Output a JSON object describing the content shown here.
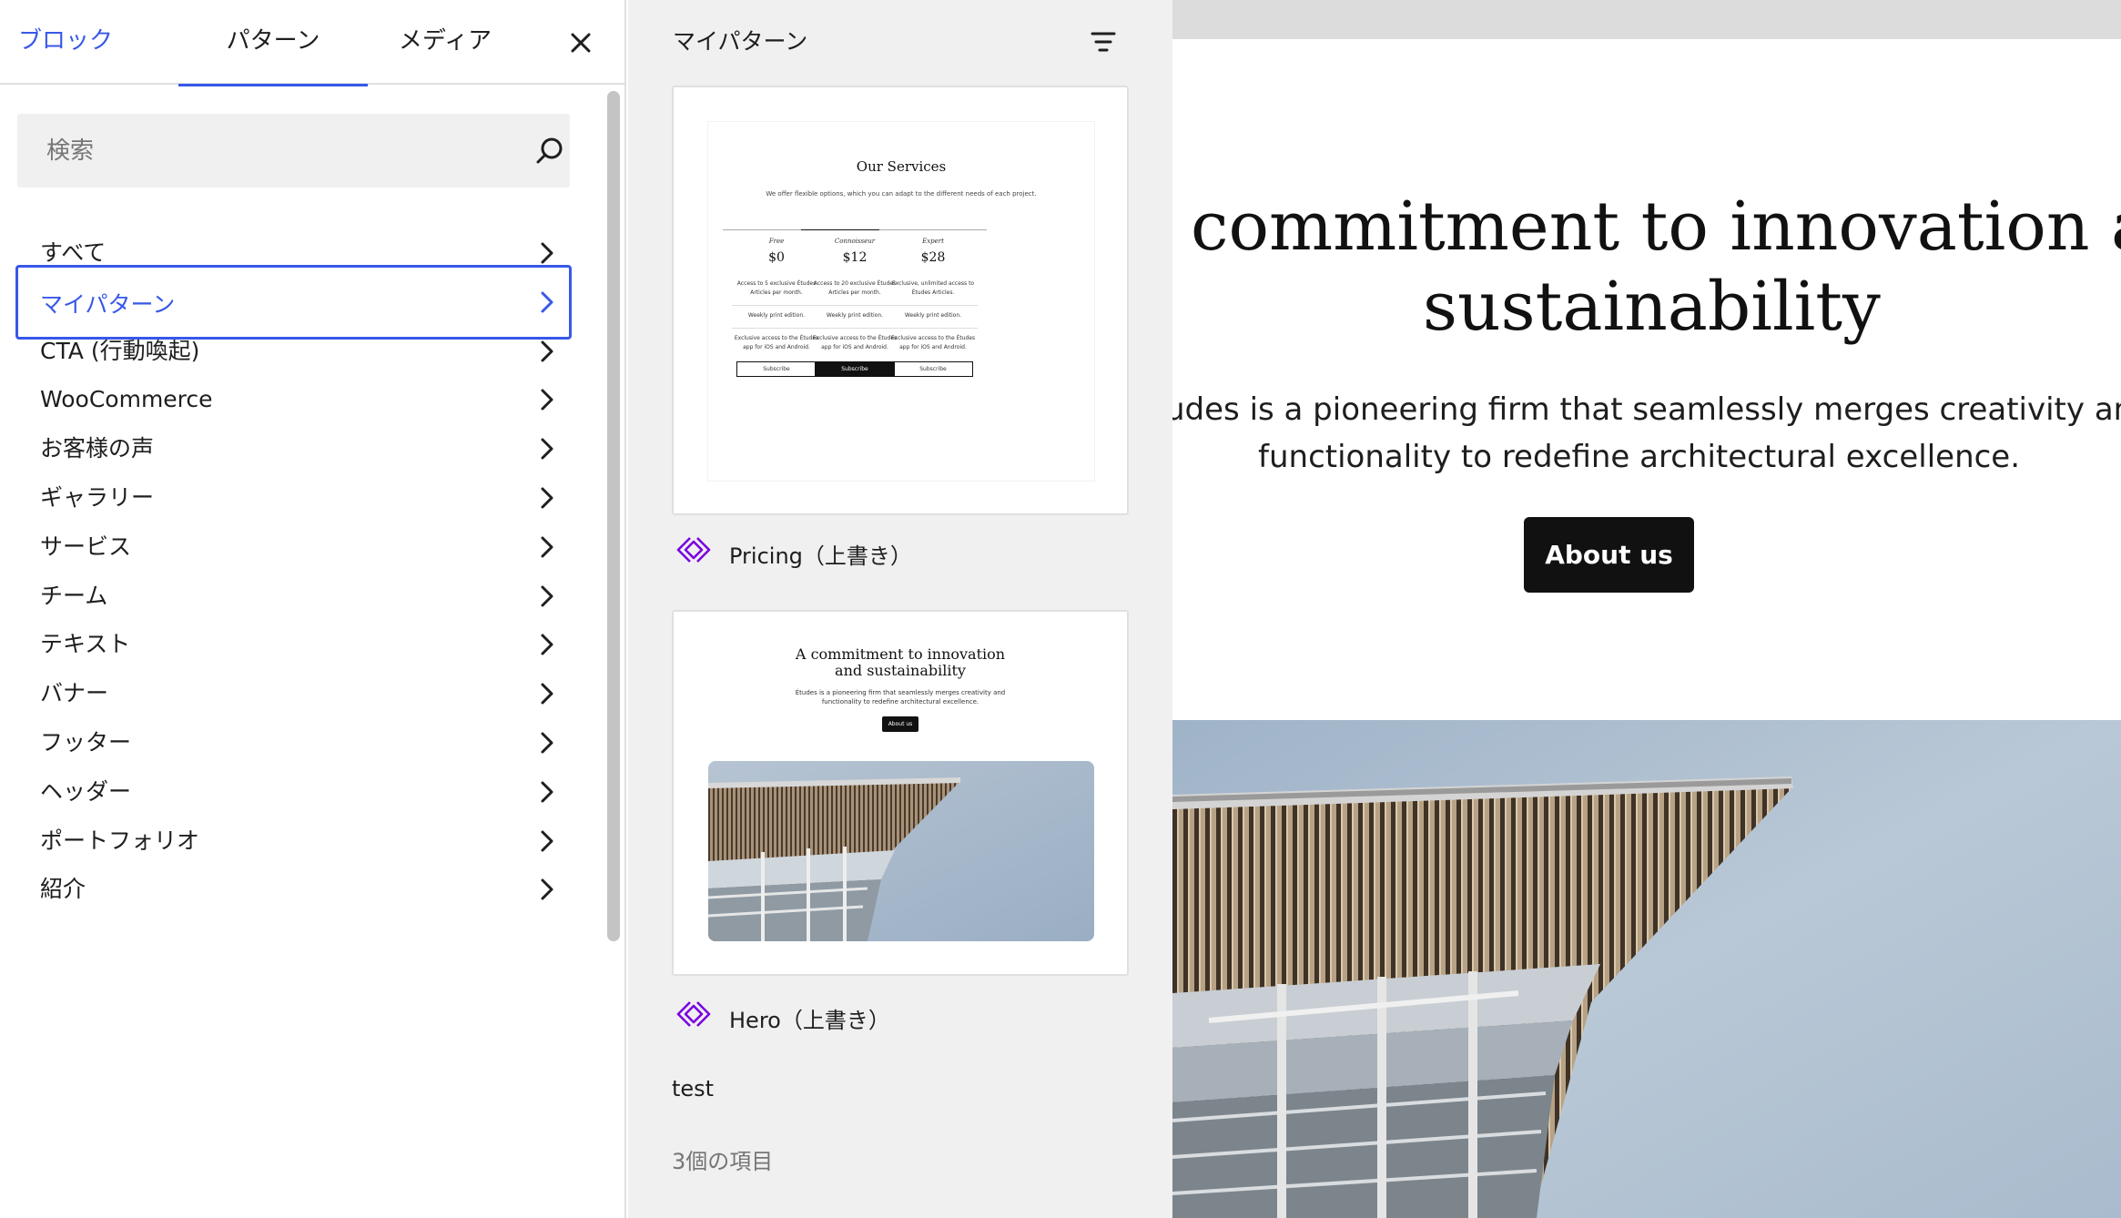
{
  "inserter": {
    "tabs": [
      {
        "label": "ブロック",
        "active": false
      },
      {
        "label": "パターン",
        "active": true
      },
      {
        "label": "メディア",
        "active": false
      }
    ],
    "close_icon": "close-icon",
    "search": {
      "placeholder": "検索",
      "value": "",
      "icon": "search-icon"
    },
    "categories": [
      {
        "label": "すべて",
        "selected": false
      },
      {
        "label": "マイパターン",
        "selected": true
      },
      {
        "label": "CTA (行動喚起)",
        "selected": false
      },
      {
        "label": "WooCommerce",
        "selected": false
      },
      {
        "label": "お客様の声",
        "selected": false
      },
      {
        "label": "ギャラリー",
        "selected": false
      },
      {
        "label": "サービス",
        "selected": false
      },
      {
        "label": "チーム",
        "selected": false
      },
      {
        "label": "テキスト",
        "selected": false
      },
      {
        "label": "バナー",
        "selected": false
      },
      {
        "label": "フッター",
        "selected": false
      },
      {
        "label": "ヘッダー",
        "selected": false
      },
      {
        "label": "ポートフォリオ",
        "selected": false
      },
      {
        "label": "紹介",
        "selected": false
      }
    ]
  },
  "patterns": {
    "title": "マイパターン",
    "filter_icon": "filter-icon",
    "items": [
      {
        "label": "Pricing（上書き）",
        "icon": "synced-pattern-icon",
        "preview": {
          "title": "Our Services",
          "subtitle": "We offer flexible options, which you can adapt to the different needs of each project.",
          "columns": [
            {
              "tier": "Free",
              "price": "$0",
              "features": [
                "Access to 5 exclusive Études Articles per month.",
                "Weekly print edition.",
                "Exclusive access to the Études app for iOS and Android."
              ],
              "button": "Subscribe",
              "highlight": false
            },
            {
              "tier": "Connoisseur",
              "price": "$12",
              "features": [
                "Access to 20 exclusive Études Articles per month.",
                "Weekly print edition.",
                "Exclusive access to the Études app for iOS and Android."
              ],
              "button": "Subscribe",
              "highlight": true
            },
            {
              "tier": "Expert",
              "price": "$28",
              "features": [
                "Exclusive, unlimited access to Études Articles.",
                "Weekly print edition.",
                "Exclusive access to the Études app for iOS and Android."
              ],
              "button": "Subscribe",
              "highlight": false
            }
          ]
        }
      },
      {
        "label": "Hero（上書き）",
        "icon": "synced-pattern-icon",
        "preview": {
          "title": "A commitment to innovation and sustainability",
          "subtitle": "Études is a pioneering firm that seamlessly merges creativity and functionality to redefine architectural excellence.",
          "button": "About us"
        }
      },
      {
        "label": "test"
      }
    ],
    "count": "3個の項目"
  },
  "canvas": {
    "heading_line1": "commitment to innovation and",
    "heading_line2": "sustainability",
    "desc_line1": "udes is a pioneering firm that seamlessly merges creativity and",
    "desc_line2": "functionality to redefine architectural excellence.",
    "button": "About us"
  },
  "colors": {
    "accent": "#3858e9",
    "synced_icon": "#7a00df",
    "button_dark": "#111111"
  }
}
